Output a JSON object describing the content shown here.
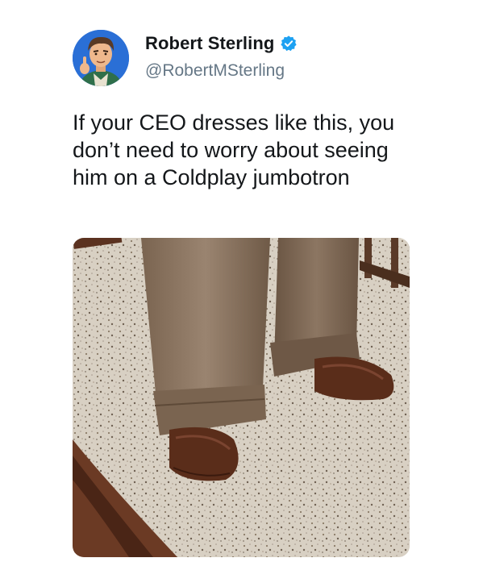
{
  "tweet": {
    "author": {
      "name": "Robert Sterling",
      "handle": "@RobertMSterling",
      "verified": true,
      "avatar_icon": "cartoon-avatar"
    },
    "text": "If your CEO dresses like this, you don’t need to worry about seeing him on a Coldplay jumbotron",
    "media": {
      "type": "photo",
      "subject": "brown trousers with cuffed hems over brown leather shoes on a speckled terrazzo floor"
    }
  },
  "colors": {
    "verified_badge": "#1da1f2",
    "name_text": "#14171a",
    "handle_text": "#657786",
    "avatar_bg": "#2a6fd6",
    "trousers": "#8a7560",
    "shoes": "#5a2d1a",
    "floor": "#d9d2c6"
  }
}
